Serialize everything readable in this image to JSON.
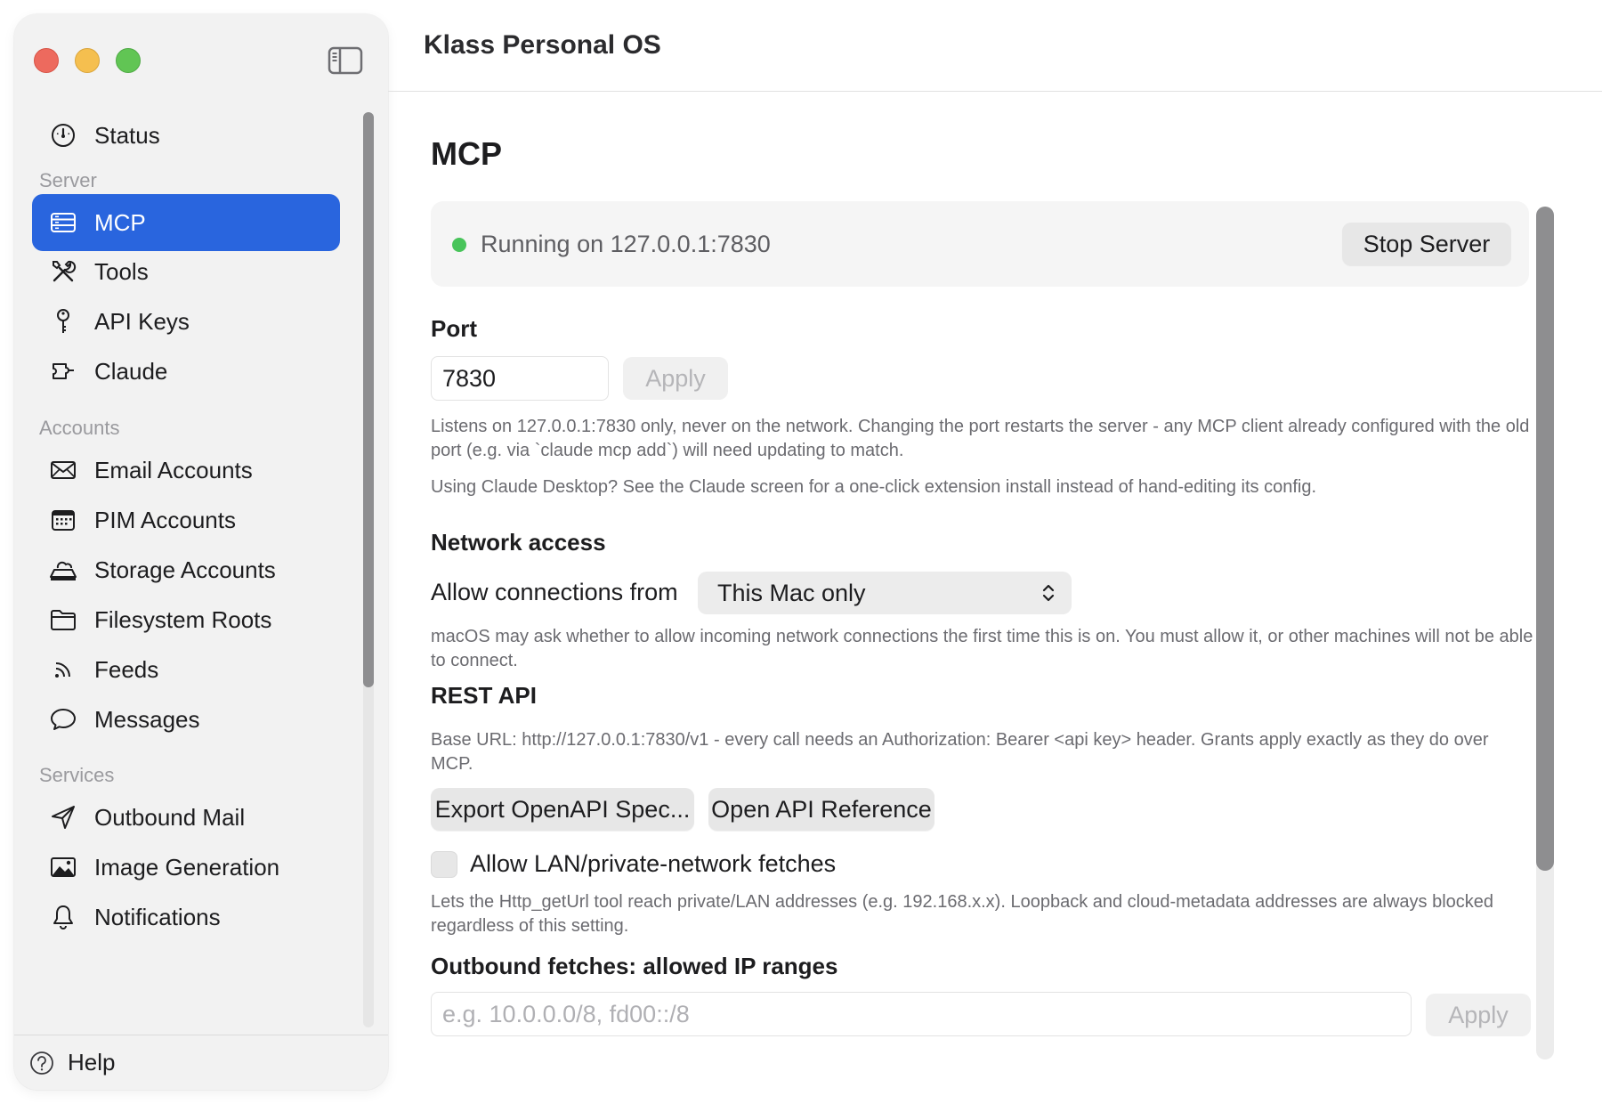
{
  "window": {
    "title": "Klass Personal OS"
  },
  "sidebar": {
    "top_item": {
      "label": "Status",
      "icon": "gauge-icon"
    },
    "sections": [
      {
        "title": "Server",
        "items": [
          {
            "label": "MCP",
            "icon": "server-icon",
            "selected": true
          },
          {
            "label": "Tools",
            "icon": "tools-icon"
          },
          {
            "label": "API Keys",
            "icon": "key-icon"
          },
          {
            "label": "Claude",
            "icon": "plug-icon"
          }
        ]
      },
      {
        "title": "Accounts",
        "items": [
          {
            "label": "Email Accounts",
            "icon": "envelope-icon"
          },
          {
            "label": "PIM Accounts",
            "icon": "calendar-icon"
          },
          {
            "label": "Storage Accounts",
            "icon": "cloud-drive-icon"
          },
          {
            "label": "Filesystem Roots",
            "icon": "folder-icon"
          },
          {
            "label": "Feeds",
            "icon": "rss-icon"
          },
          {
            "label": "Messages",
            "icon": "speech-bubble-icon"
          }
        ]
      },
      {
        "title": "Services",
        "items": [
          {
            "label": "Outbound Mail",
            "icon": "paper-plane-icon"
          },
          {
            "label": "Image Generation",
            "icon": "image-icon"
          },
          {
            "label": "Notifications",
            "icon": "bell-icon"
          }
        ]
      }
    ],
    "help": {
      "label": "Help",
      "icon": "question-circle-icon"
    }
  },
  "main": {
    "page_title": "MCP",
    "status": {
      "text": "Running on 127.0.0.1:7830",
      "indicator_color": "#48c45a",
      "stop_button": "Stop Server"
    },
    "port": {
      "heading": "Port",
      "value": "7830",
      "apply_label": "Apply",
      "desc1": "Listens on 127.0.0.1:7830 only, never on the network. Changing the port restarts the server - any MCP client already configured with the old port (e.g. via `claude mcp add`) will need updating to match.",
      "desc2": "Using Claude Desktop? See the Claude screen for a one-click extension install instead of hand-editing its config."
    },
    "network": {
      "heading": "Network access",
      "label": "Allow connections from",
      "selected": "This Mac only",
      "desc": "macOS may ask whether to allow incoming network connections the first time this is on. You must allow it, or other machines will not be able to connect."
    },
    "rest": {
      "heading": "REST API",
      "desc": "Base URL: http://127.0.0.1:7830/v1 - every call needs an Authorization: Bearer <api key> header. Grants apply exactly as they do over MCP.",
      "export_button": "Export OpenAPI Spec...",
      "reference_button": "Open API Reference"
    },
    "lan": {
      "checkbox_label": "Allow LAN/private-network fetches",
      "checked": false,
      "desc": "Lets the Http_getUrl tool reach private/LAN addresses (e.g. 192.168.x.x). Loopback and cloud-metadata addresses are always blocked regardless of this setting."
    },
    "outbound": {
      "heading": "Outbound fetches: allowed IP ranges",
      "placeholder": "e.g. 10.0.0.0/8, fd00::/8",
      "apply_label": "Apply"
    }
  },
  "colors": {
    "accent": "#2965de"
  }
}
